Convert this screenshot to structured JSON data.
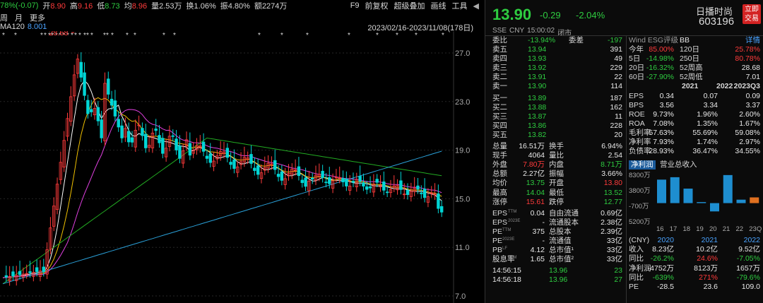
{
  "toolbar": {
    "change_pct": "78%(-0.07)",
    "open_label": "开",
    "open": "8.90",
    "high_label": "高",
    "high": "9.16",
    "low_label": "低",
    "low": "8.73",
    "avg_label": "均",
    "avg": "8.96",
    "vol_label": "量",
    "vol": "2.53万",
    "turn_label": "换",
    "turn": "1.06%",
    "amp_label": "振",
    "amp": "4.80%",
    "amt_label": "额",
    "amt": "2274万",
    "tools": [
      "F9",
      "前复权",
      "超级叠加",
      "画线",
      "工具"
    ]
  },
  "period_tabs": [
    "周",
    "月",
    "更多"
  ],
  "ma": {
    "label": "MA120",
    "value": "8.001"
  },
  "range": "2023/02/16-2023/11/08(178日)",
  "y_ticks": [
    "27.0",
    "23.0",
    "19.0",
    "15.0",
    "11.0",
    "7.0"
  ],
  "peak_label": "28.68",
  "colors": {
    "up": "#ff3b3b",
    "down": "#00d5d5",
    "ma5": "#ffffff",
    "ma10": "#f0c000",
    "ma20": "#e040e0",
    "ma60": "#22aa22",
    "ma120": "#2aa0d8"
  },
  "chart_data": {
    "type": "candlestick",
    "ylim": [
      7,
      29
    ],
    "y_ticks": [
      27,
      23,
      19,
      15,
      11,
      7
    ],
    "date_range": "2023/02/16-2023/11/08",
    "bars": 178,
    "marked_high": 28.68,
    "last_close": 13.9
  },
  "quote": {
    "price": "13.90",
    "change": "-0.29",
    "change_pct": "-2.04%",
    "exchange": "SSE",
    "currency": "CNY",
    "time": "15:00:02",
    "status": "闭市",
    "name": "日播时尚",
    "code": "603196",
    "trade_btn": [
      "立即",
      "交易"
    ],
    "wei_bi_label": "委比",
    "wei_bi": "-13.94%",
    "wei_cha_label": "委差",
    "wei_cha": "-197",
    "asks": [
      {
        "label": "卖五",
        "price": "13.94",
        "vol": "391"
      },
      {
        "label": "卖四",
        "price": "13.93",
        "vol": "49"
      },
      {
        "label": "卖三",
        "price": "13.92",
        "vol": "229"
      },
      {
        "label": "卖二",
        "price": "13.91",
        "vol": "22"
      },
      {
        "label": "卖一",
        "price": "13.90",
        "vol": "114"
      }
    ],
    "bids": [
      {
        "label": "买一",
        "price": "13.89",
        "vol": "187"
      },
      {
        "label": "买二",
        "price": "13.88",
        "vol": "162"
      },
      {
        "label": "买三",
        "price": "13.87",
        "vol": "11"
      },
      {
        "label": "买四",
        "price": "13.86",
        "vol": "228"
      },
      {
        "label": "买五",
        "price": "13.82",
        "vol": "20"
      }
    ],
    "stats": [
      [
        "总量",
        "16.51万",
        "换手",
        "6.94%"
      ],
      [
        "现手",
        "4064",
        "量比",
        "2.54"
      ],
      [
        "外盘",
        "7.80万",
        "内盘",
        "8.71万"
      ],
      [
        "总额",
        "2.27亿",
        "振幅",
        "3.66%"
      ],
      [
        "均价",
        "13.75",
        "开盘",
        "13.80"
      ],
      [
        "最高",
        "14.04",
        "最低",
        "13.52"
      ],
      [
        "涨停",
        "15.61",
        "跌停",
        "12.77"
      ]
    ],
    "fin": [
      [
        "EPS",
        "TTM",
        "0.04",
        "自由流通",
        "0.69亿"
      ],
      [
        "EPS",
        "2023E",
        "-",
        "流通股本",
        "2.38亿"
      ],
      [
        "PE",
        "TTM",
        "375",
        "总股本",
        "2.39亿"
      ],
      [
        "PE",
        "2023E",
        "-",
        "流通值",
        "33亿"
      ],
      [
        "PB",
        "LF",
        "4.12",
        "总市值¹",
        "33亿"
      ],
      [
        "股息率",
        "TTM",
        "1.65",
        "总市值²",
        "33亿"
      ]
    ],
    "ticks": [
      [
        "14:56:15",
        "13.96",
        "23"
      ],
      [
        "14:56:18",
        "13.96",
        "27"
      ]
    ]
  },
  "esg": {
    "label": "Wind ESG评级",
    "rating": "BB",
    "detail": "详情",
    "perf": [
      [
        "今年",
        "85.00%",
        "120日",
        "25.78%"
      ],
      [
        "5日",
        "-14.98%",
        "250日",
        "80.78%"
      ],
      [
        "20日",
        "-16.32%",
        "52周高",
        "28.68"
      ],
      [
        "60日",
        "-27.90%",
        "52周低",
        "7.01"
      ]
    ],
    "year_head": [
      "2021",
      "2022",
      "2023Q3"
    ],
    "fund_rows": [
      [
        "EPS",
        "0.34",
        "0.07",
        "0.09"
      ],
      [
        "BPS",
        "3.56",
        "3.34",
        "3.37"
      ],
      [
        "ROE",
        "9.73%",
        "1.96%",
        "2.60%"
      ],
      [
        "ROA",
        "7.08%",
        "1.35%",
        "1.67%"
      ],
      [
        "毛利率",
        "57.63%",
        "55.69%",
        "59.08%"
      ],
      [
        "净利率",
        "7.93%",
        "1.74%",
        "2.97%"
      ],
      [
        "负债率",
        "28.93%",
        "36.47%",
        "34.55%"
      ]
    ]
  },
  "profit_chart": {
    "tab1": "净利润",
    "tab2": "营业总收入",
    "y_labels": [
      "8300万",
      "3800万",
      "-700万",
      "5200万"
    ],
    "x_labels": [
      "16",
      "17",
      "18",
      "19",
      "20",
      "21",
      "22",
      "23Q3"
    ],
    "values": [
      6800,
      7500,
      4200,
      300,
      -2400,
      8123,
      1000,
      1657
    ],
    "unit": "万"
  },
  "annual": {
    "unit": "(CNY)",
    "years": [
      "2020",
      "2021",
      "2022"
    ],
    "rows": [
      [
        "收入",
        "8.23亿",
        "10.2亿",
        "9.52亿"
      ],
      [
        "同比",
        "-26.2%",
        "24.6%",
        "-7.05%"
      ],
      [
        "净利润",
        "-4752万",
        "8123万",
        "1657万"
      ],
      [
        "同比",
        "-639%",
        "271%",
        "-79.6%"
      ],
      [
        "PE",
        "-28.5",
        "23.6",
        "109.0"
      ]
    ]
  }
}
